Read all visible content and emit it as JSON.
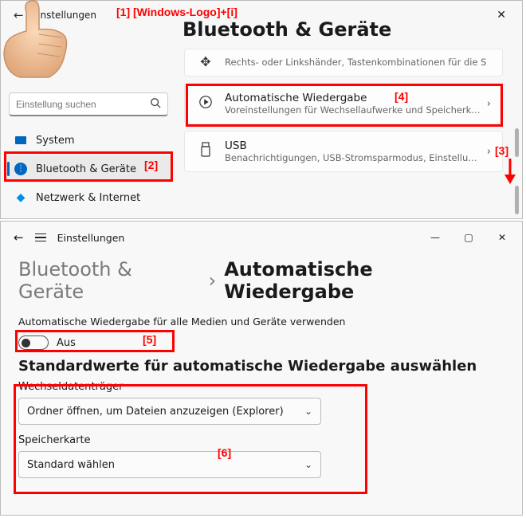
{
  "annotations": {
    "a1": "[1]  [Windows-Logo]+[i]",
    "a2": "[2]",
    "a3": "[3]",
    "a4": "[4]",
    "a5": "[5]",
    "a6": "[6]"
  },
  "win1": {
    "title_small": "Einstellungen",
    "header": "Bluetooth & Geräte",
    "search_placeholder": "Einstellung suchen",
    "sidebar": {
      "items": [
        {
          "label": "System"
        },
        {
          "label": "Bluetooth & Geräte"
        },
        {
          "label": "Netzwerk & Internet"
        }
      ]
    },
    "cards": {
      "top_sub": "Rechts- oder Linkshänder, Tastenkombinationen für die S",
      "autoplay": {
        "title": "Automatische Wiedergabe",
        "sub": "Voreinstellungen für Wechsellaufwerke und Speicherkart"
      },
      "usb": {
        "title": "USB",
        "sub": "Benachrichtigungen, USB-Stromsparmodus, Einstellungen"
      }
    }
  },
  "win2": {
    "title_small": "Einstellungen",
    "breadcrumb_parent": "Bluetooth & Geräte",
    "breadcrumb_sep": "›",
    "breadcrumb_current": "Automatische Wiedergabe",
    "section_label": "Automatische Wiedergabe für alle Medien und Geräte verwenden",
    "toggle_label": "Aus",
    "subheading": "Standardwerte für automatische Wiedergabe auswählen",
    "field1_label": "Wechseldatenträger",
    "field1_value": "Ordner öffnen, um Dateien anzuzeigen (Explorer)",
    "field2_label": "Speicherkarte",
    "field2_value": "Standard wählen"
  }
}
